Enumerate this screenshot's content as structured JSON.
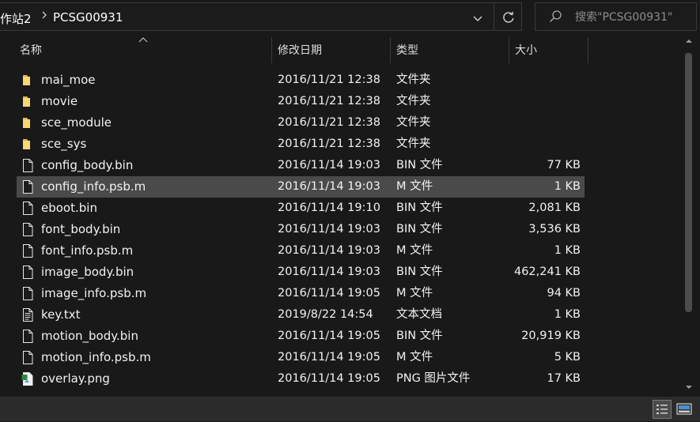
{
  "address_bar": {
    "crumbs": [
      "作站2",
      "PCSG00931"
    ],
    "dropdown_icon": "chevron-down-icon",
    "refresh_icon": "refresh-icon"
  },
  "search": {
    "placeholder": "搜索\"PCSG00931\"",
    "icon": "search-icon"
  },
  "columns": {
    "name": "名称",
    "date": "修改日期",
    "type": "类型",
    "size": "大小"
  },
  "files": [
    {
      "name": "mai_moe",
      "date": "2016/11/21 12:38",
      "type": "文件夹",
      "size": "",
      "icon": "folder-icon"
    },
    {
      "name": "movie",
      "date": "2016/11/21 12:38",
      "type": "文件夹",
      "size": "",
      "icon": "folder-icon"
    },
    {
      "name": "sce_module",
      "date": "2016/11/21 12:38",
      "type": "文件夹",
      "size": "",
      "icon": "folder-icon"
    },
    {
      "name": "sce_sys",
      "date": "2016/11/21 12:38",
      "type": "文件夹",
      "size": "",
      "icon": "folder-icon"
    },
    {
      "name": "config_body.bin",
      "date": "2016/11/14 19:03",
      "type": "BIN 文件",
      "size": "77 KB",
      "icon": "file-icon"
    },
    {
      "name": "config_info.psb.m",
      "date": "2016/11/14 19:03",
      "type": "M 文件",
      "size": "1 KB",
      "icon": "file-icon",
      "selected": true
    },
    {
      "name": "eboot.bin",
      "date": "2016/11/14 19:10",
      "type": "BIN 文件",
      "size": "2,081 KB",
      "icon": "file-icon"
    },
    {
      "name": "font_body.bin",
      "date": "2016/11/14 19:03",
      "type": "BIN 文件",
      "size": "3,536 KB",
      "icon": "file-icon"
    },
    {
      "name": "font_info.psb.m",
      "date": "2016/11/14 19:03",
      "type": "M 文件",
      "size": "1 KB",
      "icon": "file-icon"
    },
    {
      "name": "image_body.bin",
      "date": "2016/11/14 19:03",
      "type": "BIN 文件",
      "size": "462,241 KB",
      "icon": "file-icon"
    },
    {
      "name": "image_info.psb.m",
      "date": "2016/11/14 19:05",
      "type": "M 文件",
      "size": "94 KB",
      "icon": "file-icon"
    },
    {
      "name": "key.txt",
      "date": "2019/8/22 14:54",
      "type": "文本文档",
      "size": "1 KB",
      "icon": "text-file-icon"
    },
    {
      "name": "motion_body.bin",
      "date": "2016/11/14 19:05",
      "type": "BIN 文件",
      "size": "20,919 KB",
      "icon": "file-icon"
    },
    {
      "name": "motion_info.psb.m",
      "date": "2016/11/14 19:05",
      "type": "M 文件",
      "size": "5 KB",
      "icon": "file-icon"
    },
    {
      "name": "overlay.png",
      "date": "2016/11/14 19:05",
      "type": "PNG 图片文件",
      "size": "17 KB",
      "icon": "image-file-icon"
    }
  ],
  "statusbar": {
    "details_view_icon": "details-view-icon",
    "tiles_view_icon": "large-icons-view-icon"
  },
  "colors": {
    "background": "#191919",
    "selected_row": "#4a4a4a",
    "folder": "#f8d775",
    "text": "#ffffff"
  }
}
